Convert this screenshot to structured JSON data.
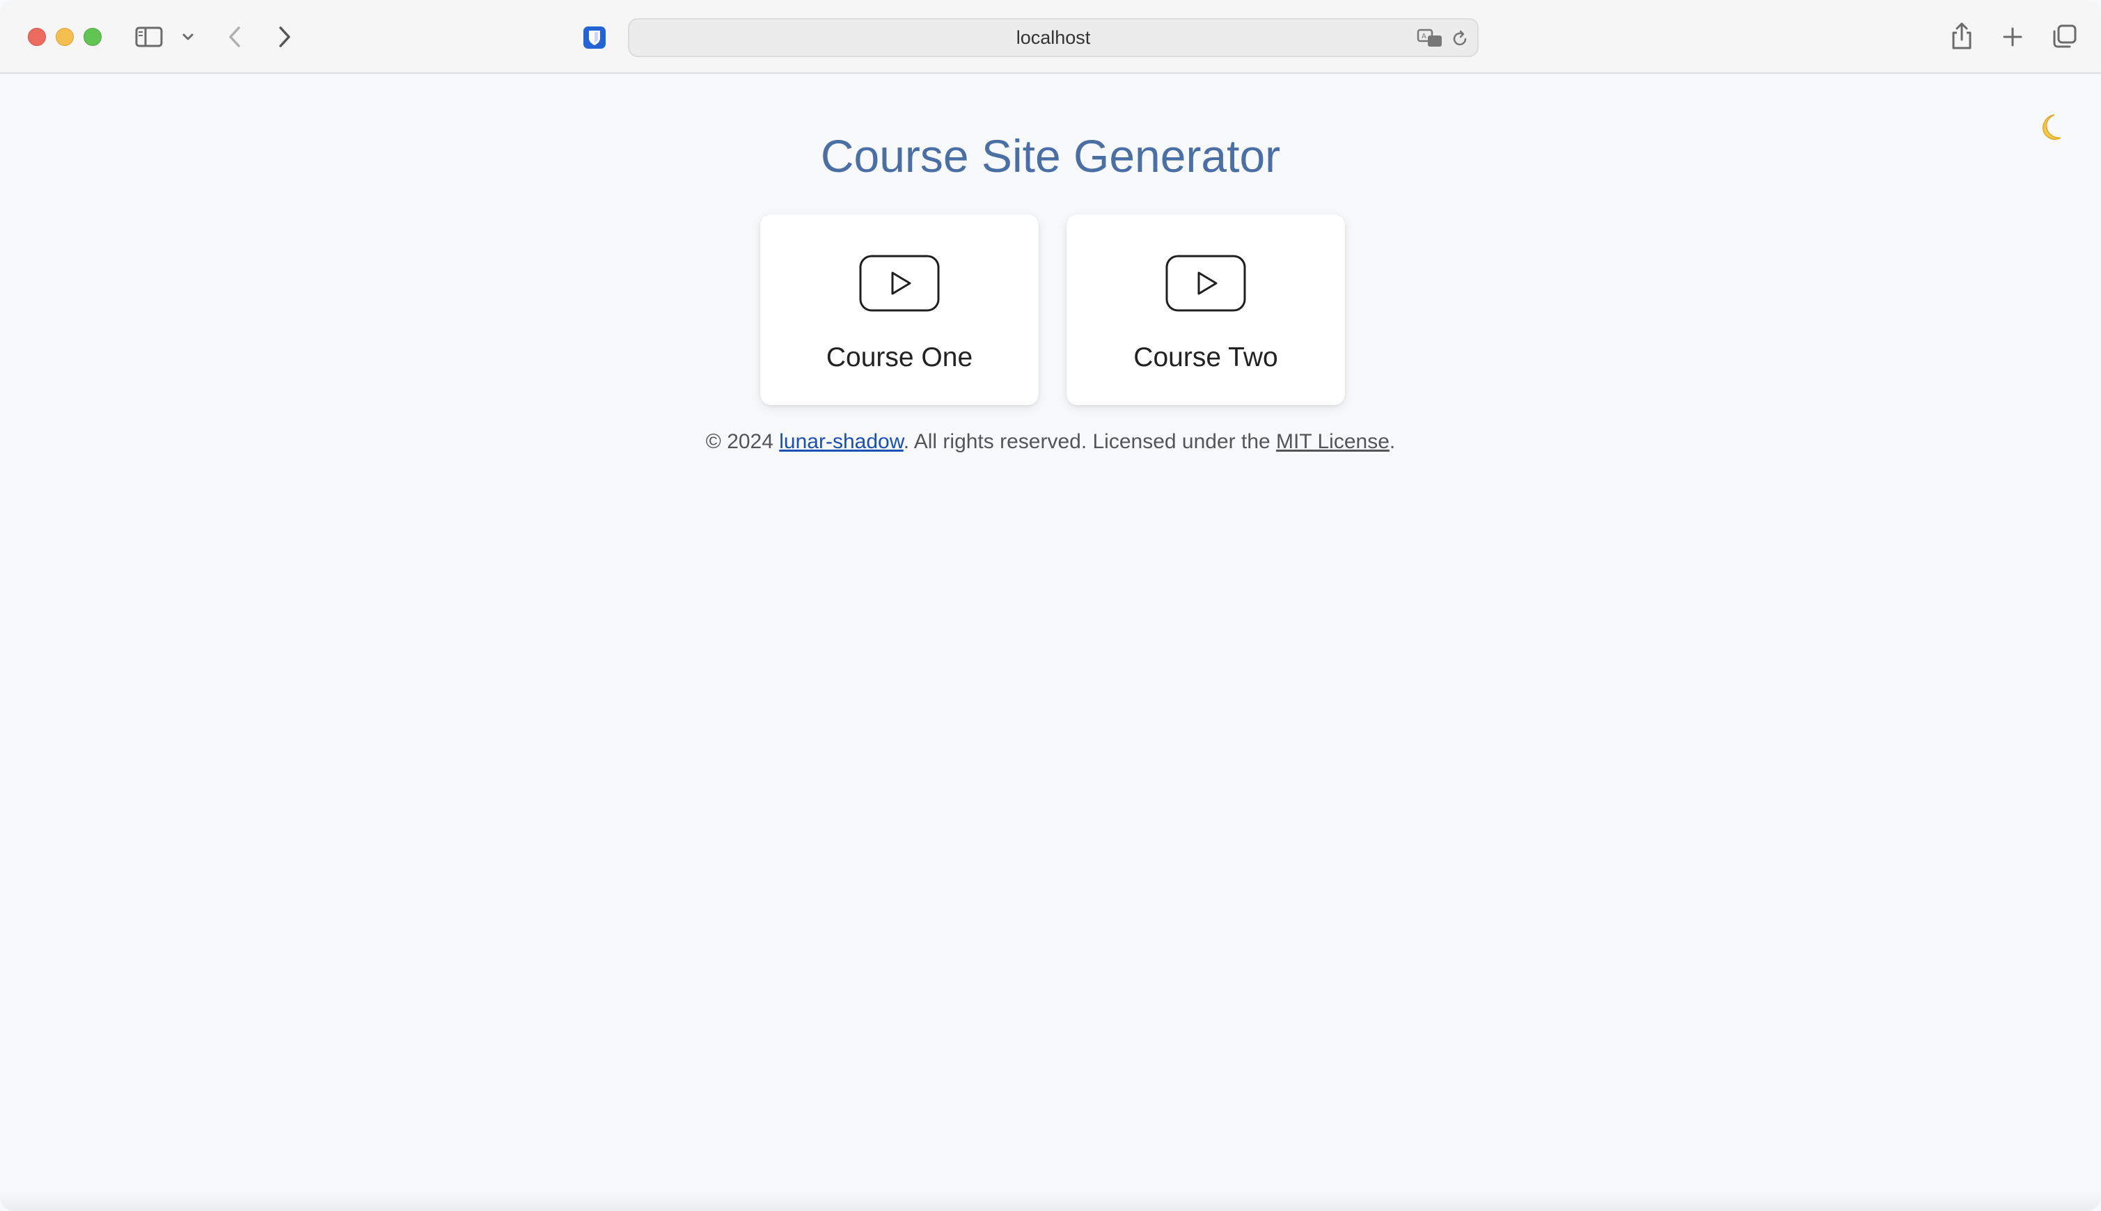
{
  "browser": {
    "url": "localhost",
    "icons": {
      "sidebar": "sidebar-icon",
      "sidebar_menu": "chevron-down-icon",
      "back": "chevron-left-icon",
      "forward": "chevron-right-icon",
      "extension": "bitwarden-shield-icon",
      "translate": "translate-icon",
      "reload": "reload-icon",
      "share": "share-icon",
      "new_tab": "plus-icon",
      "tab_overview": "tabs-overview-icon"
    }
  },
  "page": {
    "title": "Course Site Generator",
    "theme_toggle_icon": "🌙",
    "courses": [
      {
        "label": "Course One",
        "icon": "play-video-icon"
      },
      {
        "label": "Course Two",
        "icon": "play-video-icon"
      }
    ],
    "footer": {
      "prefix": "© 2024 ",
      "author": "lunar-shadow",
      "middle": ". All rights reserved. Licensed under the ",
      "license": "MIT License",
      "suffix": "."
    }
  },
  "colors": {
    "title": "#4a6fa5",
    "link": "#1a4fb5",
    "background": "#f7f9fb",
    "extension_accent": "#2463d6"
  }
}
